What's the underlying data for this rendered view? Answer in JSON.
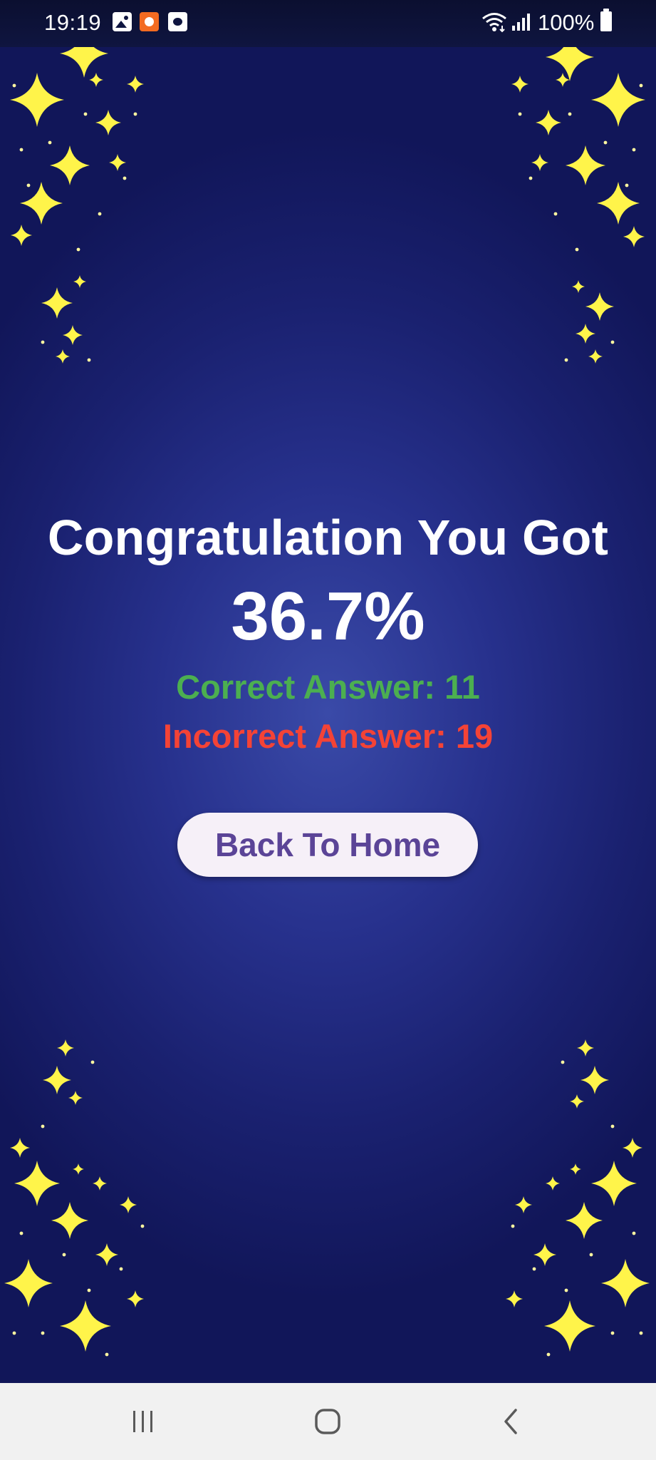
{
  "status_bar": {
    "time": "19:19",
    "battery": "100%",
    "icons": [
      "gallery-icon",
      "app-notification-icon",
      "screenshot-icon",
      "wifi-icon",
      "signal-icon",
      "battery-icon"
    ]
  },
  "result": {
    "title": "Congratulation You Got",
    "score": "36.7%",
    "correct": "Correct Answer: 11",
    "incorrect": "Incorrect Answer: 19",
    "back_button": "Back To Home"
  },
  "navigation_bar": {
    "icons": [
      "recents-icon",
      "home-icon",
      "back-icon"
    ]
  },
  "colors": {
    "background_center": "#3a4aa8",
    "background_edge": "#111659",
    "correct": "#4caf50",
    "incorrect": "#f44336",
    "button_background": "#f6f0f8",
    "button_text": "#5b4497",
    "sparkle": "#fff44a"
  }
}
